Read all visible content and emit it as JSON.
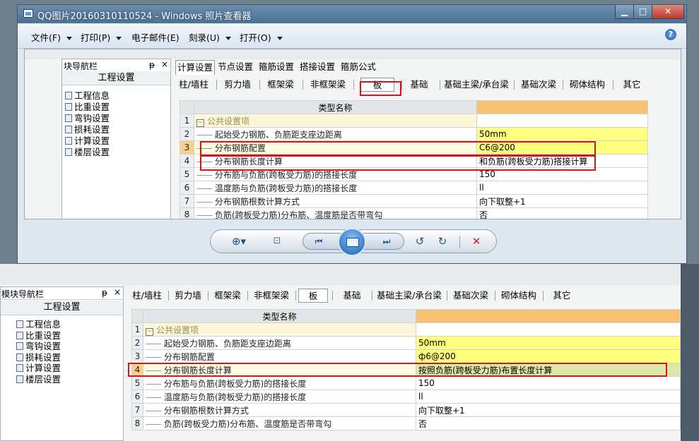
{
  "window": {
    "title": "QQ图片20160310110524 - Windows 照片查看器",
    "min_label": "▁",
    "max_label": "□",
    "close_label": "✕"
  },
  "menubar": {
    "items": [
      "文件(F)",
      "打印(P)",
      "电子邮件(E)",
      "刻录(U)",
      "打开(O)"
    ],
    "help": "?"
  },
  "upper": {
    "nav_title": "块导航栏",
    "pin": "ᵽ",
    "close": "×",
    "project_label": "工程设置",
    "tree": [
      "工程信息",
      "比重设置",
      "弯钩设置",
      "损耗设置",
      "计算设置",
      "楼层设置"
    ],
    "top_tabs": [
      "计算设置",
      "节点设置",
      "箍筋设置",
      "搭接设置",
      "箍筋公式"
    ],
    "sub_tabs": [
      "柱/墙柱",
      "剪力墙",
      "框架梁",
      "非框架梁",
      "板",
      "基础",
      "基础主梁/承台梁",
      "基础次梁",
      "砌体结构",
      "其它"
    ],
    "col_header": "类型名称",
    "rows": [
      {
        "n": "1",
        "name": "公共设置项",
        "value": "",
        "group": true
      },
      {
        "n": "2",
        "name": "起始受力钢筋、负筋距支座边距离",
        "value": "50mm"
      },
      {
        "n": "3",
        "name": "分布钢筋配置",
        "value": "C6@200"
      },
      {
        "n": "4",
        "name": "分布钢筋长度计算",
        "value": "和负筋(跨板受力筋)搭接计算"
      },
      {
        "n": "5",
        "name": "分布筋与负筋(跨板受力筋)的搭接长度",
        "value": "150"
      },
      {
        "n": "6",
        "name": "温度筋与负筋(跨板受力筋)的搭接长度",
        "value": "ll"
      },
      {
        "n": "7",
        "name": "分布钢筋根数计算方式",
        "value": "向下取整+1"
      },
      {
        "n": "8",
        "name": "负筋(跨板受力筋)分布筋、温度筋是否带弯勾",
        "value": "否"
      }
    ]
  },
  "lower": {
    "nav_title": "模块导航栏",
    "pin": "ᵽ",
    "close": "×",
    "project_label": "工程设置",
    "tree": [
      "工程信息",
      "比重设置",
      "弯钩设置",
      "损耗设置",
      "计算设置",
      "楼层设置"
    ],
    "sub_tabs": [
      "柱/墙柱",
      "剪力墙",
      "框架梁",
      "非框架梁",
      "板",
      "基础",
      "基础主梁/承台梁",
      "基础次梁",
      "砌体结构",
      "其它"
    ],
    "col_header": "类型名称",
    "rows": [
      {
        "n": "1",
        "name": "公共设置项",
        "value": "",
        "group": true
      },
      {
        "n": "2",
        "name": "起始受力钢筋、负筋距支座边距离",
        "value": "50mm"
      },
      {
        "n": "3",
        "name": "分布钢筋配置",
        "value": "ф6@200"
      },
      {
        "n": "4",
        "name": "分布钢筋长度计算",
        "value": "按照负筋(跨板受力筋)布置长度计算"
      },
      {
        "n": "5",
        "name": "分布筋与负筋(跨板受力筋)的搭接长度",
        "value": "150"
      },
      {
        "n": "6",
        "name": "温度筋与负筋(跨板受力筋)的搭接长度",
        "value": "ll"
      },
      {
        "n": "7",
        "name": "分布钢筋根数计算方式",
        "value": "向下取整+1"
      },
      {
        "n": "8",
        "name": "负筋(跨板受力筋)分布筋、温度筋是否带弯勾",
        "value": "否"
      }
    ]
  },
  "icons": [
    "app-icon",
    "help-icon",
    "zoom-icon",
    "fit-icon",
    "prev-icon",
    "slideshow-icon",
    "next-icon",
    "rotate-left-icon",
    "rotate-right-icon",
    "delete-icon"
  ],
  "colors": {
    "highlight_box": "#d2161e",
    "value_yellow": "#ffff7e",
    "header_orange": "#f8c272"
  }
}
